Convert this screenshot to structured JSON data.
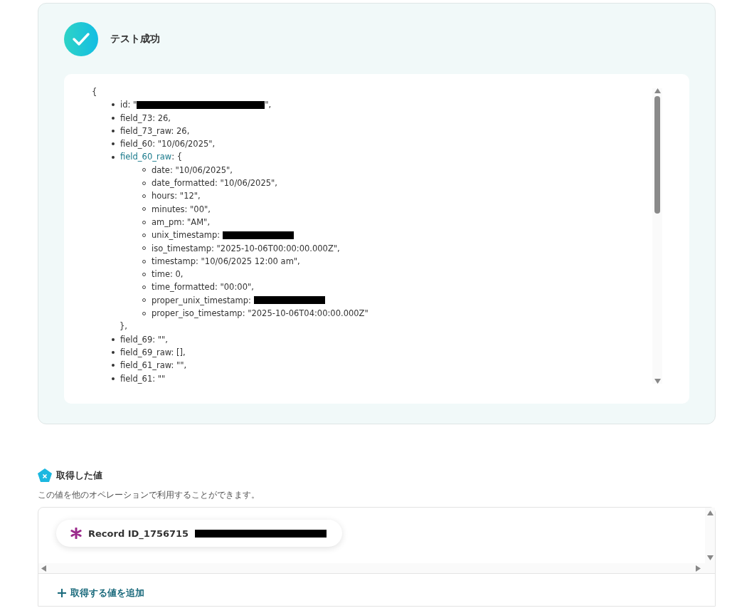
{
  "result": {
    "title": "テスト成功",
    "open_brace": "{",
    "items": [
      {
        "text": "id: \"",
        "redacted": true,
        "after": "\","
      },
      {
        "text": "field_73: 26,"
      },
      {
        "text": "field_73_raw: 26,"
      },
      {
        "text": "field_60: \"10/06/2025\","
      },
      {
        "key": "field_60_raw",
        "text": ": {",
        "close": "},",
        "children": [
          {
            "text": "date: \"10/06/2025\","
          },
          {
            "text": "date_formatted: \"10/06/2025\","
          },
          {
            "text": "hours: \"12\","
          },
          {
            "text": "minutes: \"00\","
          },
          {
            "text": "am_pm: \"AM\","
          },
          {
            "text": "unix_timestamp: ",
            "redacted": true
          },
          {
            "text": "iso_timestamp: \"2025-10-06T00:00:00.000Z\","
          },
          {
            "text": "timestamp: \"10/06/2025 12:00 am\","
          },
          {
            "text": "time: 0,"
          },
          {
            "text": "time_formatted: \"00:00\","
          },
          {
            "text": "proper_unix_timestamp: ",
            "redacted": true
          },
          {
            "text": "proper_iso_timestamp: \"2025-10-06T04:00:00.000Z\""
          }
        ]
      },
      {
        "text": "field_69: \"\","
      },
      {
        "text": "field_69_raw: [],"
      },
      {
        "text": "field_61_raw: \"\","
      },
      {
        "text": "field_61: \"\""
      }
    ]
  },
  "values": {
    "title": "取得した値",
    "description": "この値を他のオペレーションで利用することができます。",
    "chips": [
      {
        "label": "Record ID_1756715",
        "redacted": true
      }
    ],
    "add_button": "取得する値を追加"
  }
}
